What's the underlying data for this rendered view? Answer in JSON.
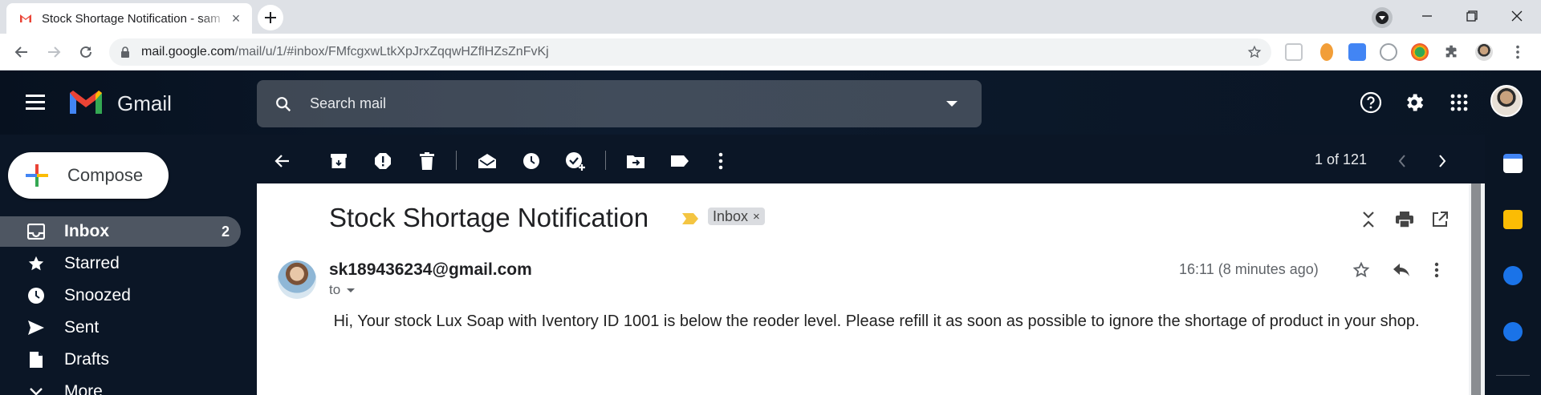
{
  "browser": {
    "tab_title": "Stock Shortage Notification - sam",
    "url_domain": "mail.google.com",
    "url_path": "/mail/u/1/#inbox/FMfcgxwLtkXpJrxZqqwHZflHZsZnFvKj"
  },
  "gmail": {
    "logo_text": "Gmail",
    "search_placeholder": "Search mail"
  },
  "sidebar": {
    "compose_label": "Compose",
    "items": [
      {
        "label": "Inbox",
        "count": "2",
        "icon": "inbox-icon"
      },
      {
        "label": "Starred",
        "icon": "star-icon"
      },
      {
        "label": "Snoozed",
        "icon": "clock-icon"
      },
      {
        "label": "Sent",
        "icon": "send-icon"
      },
      {
        "label": "Drafts",
        "icon": "draft-icon"
      },
      {
        "label": "More",
        "icon": "chevron-down-icon"
      }
    ]
  },
  "toolbar": {
    "pager": "1 of 121"
  },
  "message": {
    "subject": "Stock Shortage Notification",
    "label_chip": "Inbox",
    "sender": "sk189436234@gmail.com",
    "to_label": "to",
    "timestamp": "16:11 (8 minutes ago)",
    "body": "Hi, Your stock Lux Soap with Iventory ID 1001 is below the reoder level. Please refill it as soon as possible to ignore the shortage of product in your shop."
  },
  "colors": {
    "header_bg": "#0c1a2d",
    "accent_yellow": "#f4c542"
  }
}
